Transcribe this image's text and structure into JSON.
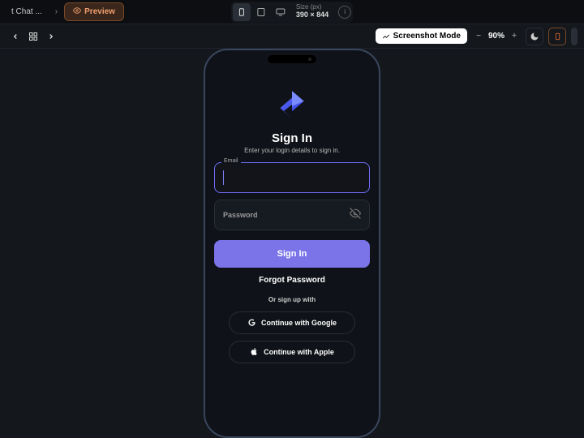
{
  "topbar": {
    "tab_label": "t Chat ...",
    "preview_label": "Preview",
    "size_caption": "Size (px)",
    "dimensions": "390 × 844"
  },
  "secbar": {
    "mode_label": "Screenshot Mode",
    "zoom_value": "90%"
  },
  "app": {
    "title": "Sign In",
    "subtitle": "Enter your login details to sign in.",
    "email_label": "Email",
    "password_label": "Password",
    "signin_button": "Sign In",
    "forgot_label": "Forgot Password",
    "or_signup": "Or sign up with",
    "google_label": "Continue with Google",
    "apple_label": "Continue with Apple"
  },
  "colors": {
    "accent": "#7a74e8",
    "focus_border": "#6e6ef7",
    "preview_border": "#7a4a2a"
  }
}
